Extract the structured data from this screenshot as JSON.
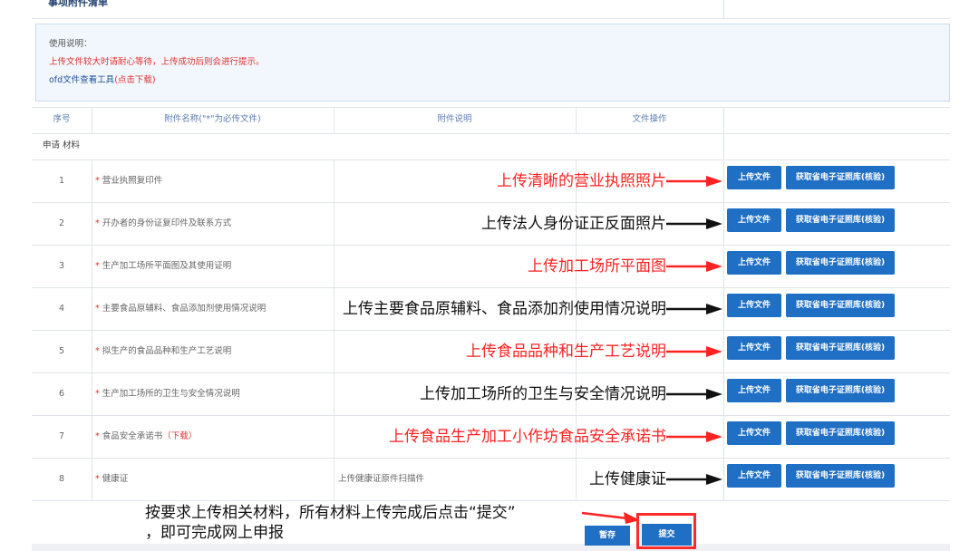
{
  "section": {
    "title": "事项附件清单"
  },
  "notice": {
    "line1": "使用说明：",
    "line2": "上传文件较大时请耐心等待，上传成功后则会进行提示。",
    "line3": "ofd文件查看工具",
    "line3_link": "(点击下载)"
  },
  "table": {
    "headers": [
      "序号",
      "附件名称(\"*\"为必传文件)",
      "附件说明",
      "文件操作"
    ],
    "group_label": "申请 材料",
    "rows": [
      {
        "num": "1",
        "name": "营业执照复印件",
        "desc": "",
        "upload": "上传文件",
        "fetch": "获取省电子证照库(核验)",
        "annotation": "上传清晰的营业执照照片",
        "annotation_color": "#ff2222"
      },
      {
        "num": "2",
        "name": "开办者的身份证复印件及联系方式",
        "desc": "",
        "upload": "上传文件",
        "fetch": "获取省电子证照库(核验)",
        "annotation": "上传法人身份证正反面照片",
        "annotation_color": "#111111"
      },
      {
        "num": "3",
        "name": "生产加工场所平面图及其使用证明",
        "desc": "",
        "upload": "上传文件",
        "fetch": "获取省电子证照库(核验)",
        "annotation": "上传加工场所平面图",
        "annotation_color": "#ff2222"
      },
      {
        "num": "4",
        "name": "主要食品原辅料、食品添加剂使用情况说明",
        "desc": "",
        "upload": "上传文件",
        "fetch": "获取省电子证照库(核验)",
        "annotation": "上传主要食品原辅料、食品添加剂使用情况说明",
        "annotation_color": "#111111"
      },
      {
        "num": "5",
        "name": "拟生产的食品品种和生产工艺说明",
        "desc": "",
        "upload": "上传文件",
        "fetch": "获取省电子证照库(核验)",
        "annotation": "上传食品品种和生产工艺说明",
        "annotation_color": "#ff2222"
      },
      {
        "num": "6",
        "name": "生产加工场所的卫生与安全情况说明",
        "desc": "",
        "upload": "上传文件",
        "fetch": "获取省电子证照库(核验)",
        "annotation": "上传加工场所的卫生与安全情况说明",
        "annotation_color": "#111111"
      },
      {
        "num": "7",
        "name": "食品安全承诺书",
        "name_link": "（下载）",
        "desc": "",
        "upload": "上传文件",
        "fetch": "获取省电子证照库(核验)",
        "annotation": "上传食品生产加工小作坊食品安全承诺书",
        "annotation_color": "#ff2222"
      },
      {
        "num": "8",
        "name": "健康证",
        "desc": "上传健康证原件扫描件",
        "upload": "上传文件",
        "fetch": "获取省电子证照库(核验)",
        "annotation": "上传健康证",
        "annotation_color": "#111111"
      }
    ]
  },
  "bottom": {
    "note_line1": "按要求上传相关材料，所有材料上传完成后点击“提交”",
    "note_line2": "，即可完成网上申报",
    "save": "暂存",
    "submit": "提交"
  },
  "colors": {
    "accent": "#1f6fc5",
    "annotation_red": "#ff2222",
    "highlight_box": "#ff2a2a"
  }
}
